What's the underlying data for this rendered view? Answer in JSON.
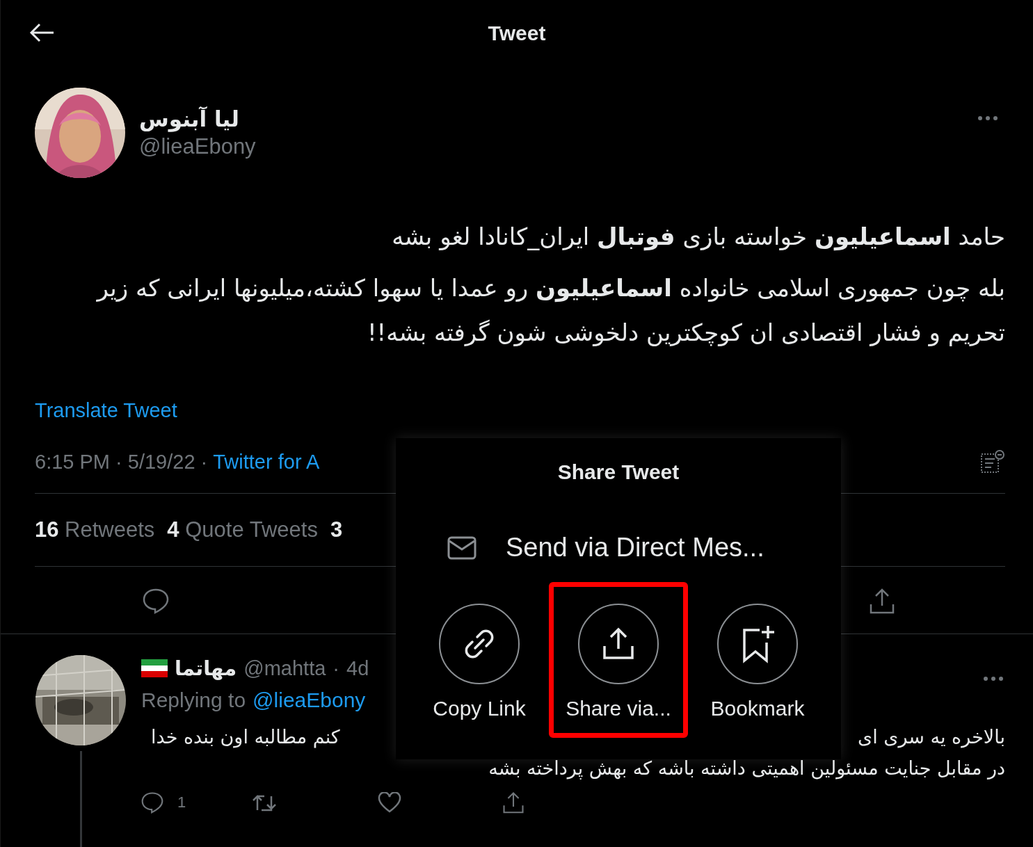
{
  "header": {
    "title": "Tweet"
  },
  "tweet": {
    "author": {
      "name": "لیا آبنوس",
      "handle": "@lieaEbony"
    },
    "paragraphs": [
      "حامد **اسماعیلیون** خواسته بازی **فوتبال** ایران_کانادا لغو بشه",
      "بله چون جمهوری اسلامی خانواده **اسماعیلیون** رو عمدا یا سهوا کشته،میلیونها ایرانی که زیر تحریم و فشار اقتصادی ان کوچکترین دلخوشی شون گرفته بشه!!"
    ],
    "translate_link": "Translate Tweet",
    "time": "6:15 PM · 5/19/22 ·",
    "source": "Twitter for A",
    "stats": {
      "retweets": {
        "count": "16",
        "label": "Retweets"
      },
      "quote_tweets": {
        "count": "4",
        "label": "Quote Tweets"
      },
      "stat_3": {
        "count": "3"
      }
    }
  },
  "reply": {
    "name": "مهاتما",
    "handle": "@mahtta",
    "separator": "·",
    "time": "4d",
    "replying_prefix": "Replying to",
    "replying_handle": "@lieaEbony",
    "text_left": "کنم مطالبه اون بنده خدا",
    "text_right": "بالاخره یه سری ای",
    "text_line_2": "در مقابل جنایت مسئولین اهمیتی داشته باشه که بهش پرداخته بشه",
    "reply_count": "1"
  },
  "share_sheet": {
    "title": "Share Tweet",
    "direct_message": "Send via Direct Mes...",
    "options": {
      "copy_link": {
        "label": "Copy Link",
        "kind": "link",
        "highlighted": false
      },
      "share_via": {
        "label": "Share via...",
        "kind": "share",
        "highlighted": true
      },
      "bookmark": {
        "label": "Bookmark",
        "kind": "bookmark",
        "highlighted": false
      }
    }
  }
}
